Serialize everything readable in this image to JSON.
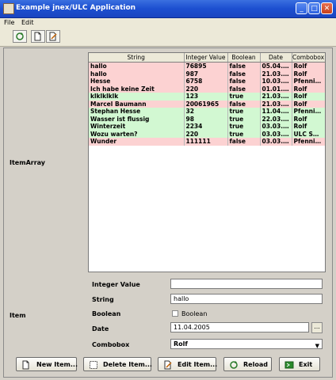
{
  "window": {
    "title": "Example jnex/ULC Application"
  },
  "menu": {
    "file": "File",
    "edit": "Edit"
  },
  "labels": {
    "item_array": "ItemArray",
    "item": "Item"
  },
  "table": {
    "columns": [
      "String",
      "Integer Value",
      "Boolean",
      "Date",
      "Combobox"
    ],
    "rows": [
      {
        "string": "hallo",
        "int": "76895",
        "bool": "false",
        "date": "05.04.2...",
        "combo": "Rolf",
        "color": "pink"
      },
      {
        "string": "hallo",
        "int": "987",
        "bool": "false",
        "date": "21.03.2...",
        "combo": "Rolf",
        "color": "pink"
      },
      {
        "string": "Hesse",
        "int": "6758",
        "bool": "false",
        "date": "10.03.2...",
        "combo": "Pfennin...",
        "color": "pink"
      },
      {
        "string": "Ich habe keine Zeit",
        "int": "220",
        "bool": "false",
        "date": "01.01.1...",
        "combo": "Rolf",
        "color": "pink"
      },
      {
        "string": "klklklklk",
        "int": "123",
        "bool": "true",
        "date": "21.03.2...",
        "combo": "Rolf",
        "color": "green"
      },
      {
        "string": "Marcel Baumann",
        "int": "20061965",
        "bool": "false",
        "date": "21.03.2...",
        "combo": "Rolf",
        "color": "pink"
      },
      {
        "string": "Stephan Hesse",
        "int": "32",
        "bool": "true",
        "date": "11.04.2...",
        "combo": "Pfennin...",
        "color": "green"
      },
      {
        "string": "Wasser ist flussig",
        "int": "98",
        "bool": "true",
        "date": "22.03.2...",
        "combo": "Rolf",
        "color": "green"
      },
      {
        "string": "Winterzeit",
        "int": "2234",
        "bool": "true",
        "date": "03.03.2...",
        "combo": "Rolf",
        "color": "green"
      },
      {
        "string": "Wozu warten?",
        "int": "220",
        "bool": "true",
        "date": "03.03.2...",
        "combo": "ULC Sp...",
        "color": "green"
      },
      {
        "string": "Wunder",
        "int": "111111",
        "bool": "false",
        "date": "03.03.2...",
        "combo": "Pfennin...",
        "color": "pink"
      }
    ]
  },
  "form": {
    "integer_label": "Integer Value",
    "integer_value": "",
    "string_label": "String",
    "string_value": "hallo",
    "boolean_label": "Boolean",
    "boolean_checkbox_label": "Boolean",
    "date_label": "Date",
    "date_value": "11.04.2005",
    "date_button": "...",
    "combobox_label": "Combobox",
    "combobox_value": "Rolf"
  },
  "buttons": {
    "new_item": "New Item...",
    "delete_item": "Delete Item...",
    "edit_item": "Edit Item...",
    "reload": "Reload",
    "exit": "Exit"
  },
  "icons": [
    "app-icon",
    "reload-icon",
    "new-doc-icon",
    "edit-doc-icon",
    "delete-icon",
    "exit-icon"
  ],
  "colors": {
    "titlebar": "#1c4fd0",
    "row_false": "#fcd2d2",
    "row_true": "#d2f8d2"
  }
}
